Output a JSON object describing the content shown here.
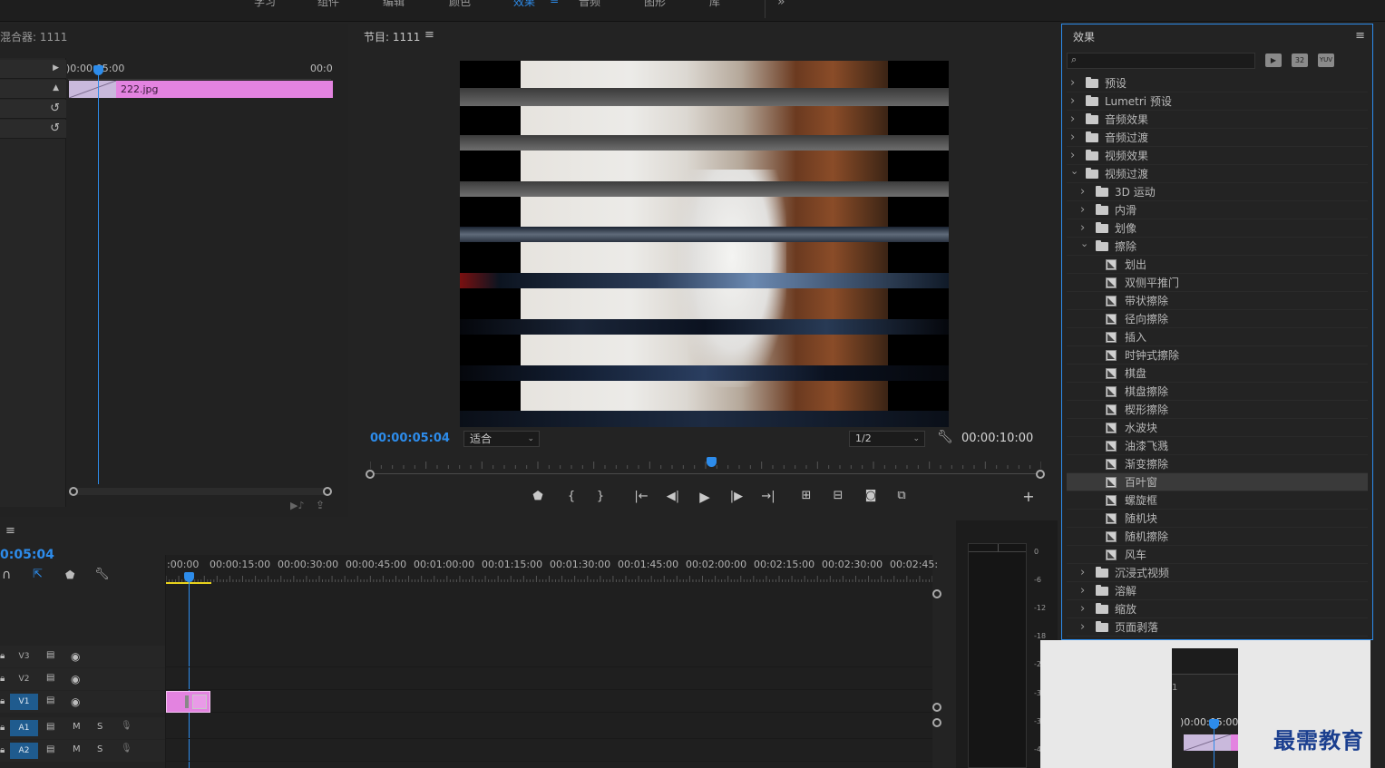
{
  "workspace_tabs": [
    {
      "label": "学习",
      "active": false
    },
    {
      "label": "组件",
      "active": false
    },
    {
      "label": "编辑",
      "active": false
    },
    {
      "label": "颜色",
      "active": false
    },
    {
      "label": "效果",
      "active": true
    },
    {
      "label": "音频",
      "active": false
    },
    {
      "label": "图形",
      "active": false
    },
    {
      "label": "库",
      "active": false
    }
  ],
  "workspace_more": "»",
  "mixer": {
    "title": "混合器: 1111",
    "timecode_start": ")0:00:05:00",
    "timecode_end": "00:0",
    "clip_name": "222.jpg"
  },
  "program": {
    "title": "节目: 1111",
    "menu_icon": "≡",
    "current_time": "00:00:05:04",
    "fit_label": "适合",
    "resolution": "1/2",
    "duration": "00:00:10:00",
    "playhead_fraction": 0.5
  },
  "timeline": {
    "timecode": "0:05:04",
    "menu_icon": "≡",
    "ruler": [
      ":00:00",
      "00:00:15:00",
      "00:00:30:00",
      "00:00:45:00",
      "00:01:00:00",
      "00:01:15:00",
      "00:01:30:00",
      "00:01:45:00",
      "00:02:00:00",
      "00:02:15:00",
      "00:02:30:00",
      "00:02:45:"
    ],
    "video_tracks": [
      "V3",
      "V2",
      "V1"
    ],
    "audio_tracks": [
      "A1",
      "A2"
    ],
    "mute_label": "M",
    "solo_label": "S"
  },
  "meter_labels": [
    "0",
    "-6",
    "-12",
    "-18",
    "-2",
    "-3",
    "-3",
    "-4"
  ],
  "effects": {
    "title": "效果",
    "menu_icon": "≡",
    "badges": [
      "32",
      "YUV"
    ],
    "items": [
      {
        "label": "预设",
        "kind": "folder-special",
        "level": 0,
        "open": false
      },
      {
        "label": "Lumetri 预设",
        "kind": "folder-special",
        "level": 0,
        "open": false
      },
      {
        "label": "音频效果",
        "kind": "folder",
        "level": 0,
        "open": false
      },
      {
        "label": "音频过渡",
        "kind": "folder",
        "level": 0,
        "open": false
      },
      {
        "label": "视频效果",
        "kind": "folder",
        "level": 0,
        "open": false
      },
      {
        "label": "视频过渡",
        "kind": "folder",
        "level": 0,
        "open": true
      },
      {
        "label": "3D 运动",
        "kind": "folder",
        "level": 1,
        "open": false
      },
      {
        "label": "内滑",
        "kind": "folder",
        "level": 1,
        "open": false
      },
      {
        "label": "划像",
        "kind": "folder",
        "level": 1,
        "open": false
      },
      {
        "label": "擦除",
        "kind": "folder",
        "level": 1,
        "open": true
      },
      {
        "label": "划出",
        "kind": "effect",
        "level": 2
      },
      {
        "label": "双侧平推门",
        "kind": "effect",
        "level": 2
      },
      {
        "label": "带状擦除",
        "kind": "effect",
        "level": 2
      },
      {
        "label": "径向擦除",
        "kind": "effect",
        "level": 2
      },
      {
        "label": "插入",
        "kind": "effect",
        "level": 2
      },
      {
        "label": "时钟式擦除",
        "kind": "effect",
        "level": 2
      },
      {
        "label": "棋盘",
        "kind": "effect",
        "level": 2
      },
      {
        "label": "棋盘擦除",
        "kind": "effect",
        "level": 2
      },
      {
        "label": "楔形擦除",
        "kind": "effect",
        "level": 2
      },
      {
        "label": "水波块",
        "kind": "effect",
        "level": 2
      },
      {
        "label": "油漆飞溅",
        "kind": "effect",
        "level": 2
      },
      {
        "label": "渐变擦除",
        "kind": "effect",
        "level": 2
      },
      {
        "label": "百叶窗",
        "kind": "effect",
        "level": 2,
        "selected": true
      },
      {
        "label": "螺旋框",
        "kind": "effect",
        "level": 2
      },
      {
        "label": "随机块",
        "kind": "effect",
        "level": 2
      },
      {
        "label": "随机擦除",
        "kind": "effect",
        "level": 2
      },
      {
        "label": "风车",
        "kind": "effect",
        "level": 2
      },
      {
        "label": "沉浸式视频",
        "kind": "folder",
        "level": 1,
        "open": false
      },
      {
        "label": "溶解",
        "kind": "folder",
        "level": 1,
        "open": false
      },
      {
        "label": "缩放",
        "kind": "folder",
        "level": 1,
        "open": false
      },
      {
        "label": "页面剥落",
        "kind": "folder",
        "level": 1,
        "open": false
      }
    ]
  },
  "overlay": {
    "timecode": ")0:00:05:00",
    "track_digit": "1"
  },
  "watermark": "最需教育",
  "colors": {
    "accent": "#2d8ceb",
    "clip_pink": "#e383e0",
    "track_blue": "#1f5b8e",
    "in_out_yellow": "#e8d21c"
  }
}
